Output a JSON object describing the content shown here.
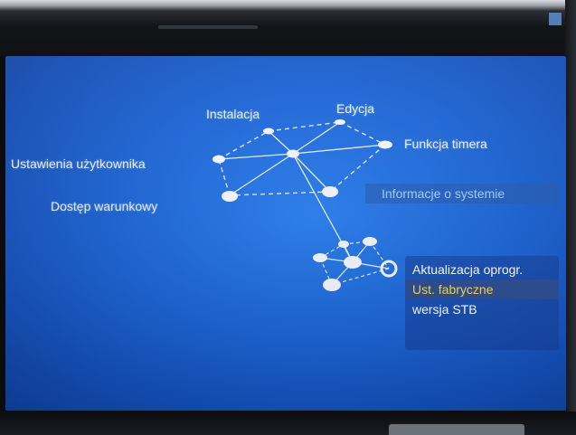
{
  "menu": {
    "nodes": [
      {
        "label": "Instalacja"
      },
      {
        "label": "Edycja"
      },
      {
        "label": "Funkcja timera"
      },
      {
        "label": "Ustawienia użytkownika"
      },
      {
        "label": "Dostęp warunkowy"
      },
      {
        "label": "Informacje o systemie"
      }
    ],
    "selected": "Informacje o systemie"
  },
  "submenu": {
    "items": [
      {
        "label": "Aktualizacja oprogr."
      },
      {
        "label": "Ust. fabryczne"
      },
      {
        "label": "wersja STB"
      }
    ],
    "selected": "Ust. fabryczne"
  },
  "colors": {
    "screen_bg": "#1a63d6",
    "selected_text": "#ffd84a",
    "label_text": "#e8f0ff"
  }
}
